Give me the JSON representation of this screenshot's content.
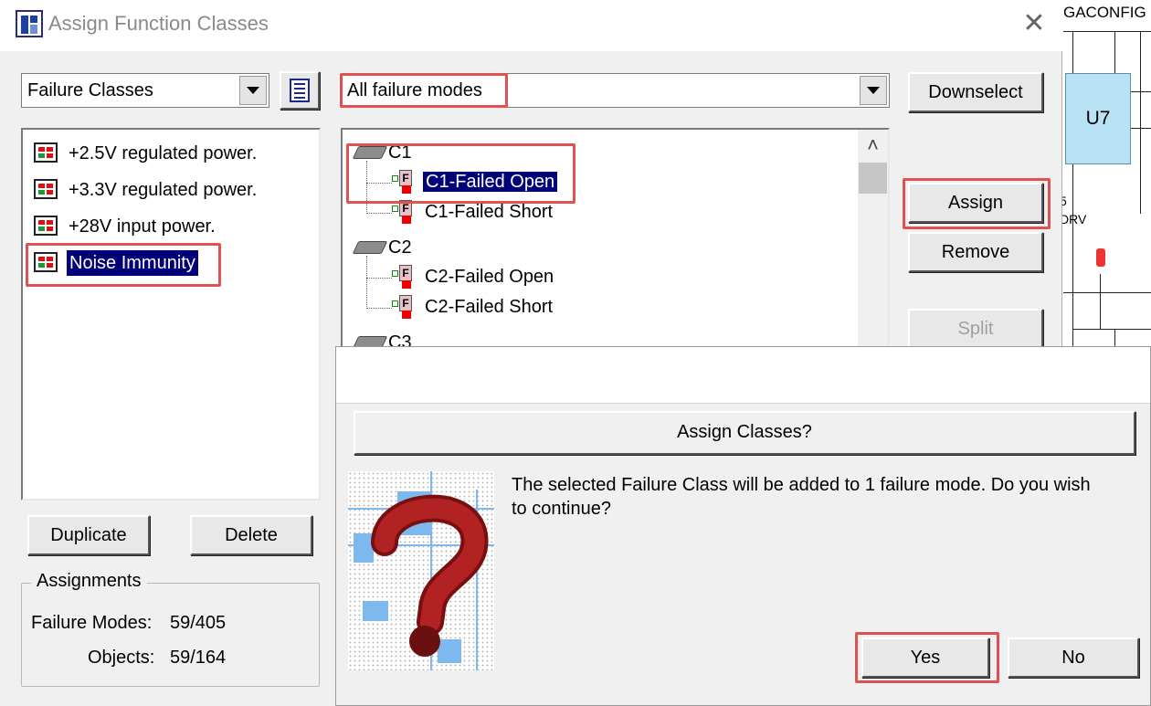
{
  "window": {
    "title": "Assign Function Classes",
    "close_glyph": "✕"
  },
  "background": {
    "schematic_label": "GACONFIG",
    "component_label": "U7",
    "small_label_1": "5",
    "small_label_2": "DRV"
  },
  "left_panel": {
    "class_type_select": {
      "value": "Failure Classes"
    },
    "list_view_icon": "list-view-icon",
    "classes": [
      {
        "label": "+2.5V regulated power."
      },
      {
        "label": "+3.3V regulated power."
      },
      {
        "label": "+28V input power."
      },
      {
        "label": "Noise Immunity",
        "selected": true
      }
    ],
    "duplicate_label": "Duplicate",
    "delete_label": "Delete",
    "assignments": {
      "legend": "Assignments",
      "failure_modes_label": "Failure Modes:",
      "failure_modes_value": "59/405",
      "objects_label": "Objects:",
      "objects_value": "59/164"
    }
  },
  "middle_panel": {
    "filter_select": {
      "value": "All failure modes"
    },
    "tree": [
      {
        "label": "C1",
        "children": [
          {
            "label": "C1-Failed Open",
            "selected": true
          },
          {
            "label": "C1-Failed Short"
          }
        ]
      },
      {
        "label": "C2",
        "children": [
          {
            "label": "C2-Failed Open"
          },
          {
            "label": "C2-Failed Short"
          }
        ]
      },
      {
        "label": "C3",
        "children": []
      }
    ],
    "scroll_up_glyph": "˄"
  },
  "right_buttons": {
    "downselect": "Downselect",
    "assign": "Assign",
    "remove": "Remove",
    "split": "Split"
  },
  "confirm_dialog": {
    "banner": "Assign Classes?",
    "message": "The selected Failure Class will be added to 1 failure mode. Do you wish to continue?",
    "message_line1": "The selected Failure Class will be added to 1 failure mode. Do you wish",
    "message_line2": "to continue?",
    "yes_label": "Yes",
    "no_label": "No",
    "image_icon": "question-mark-icon"
  },
  "colors": {
    "highlight": "#e05252",
    "selection": "#000078",
    "dialog_bg": "#f0f0f0"
  }
}
